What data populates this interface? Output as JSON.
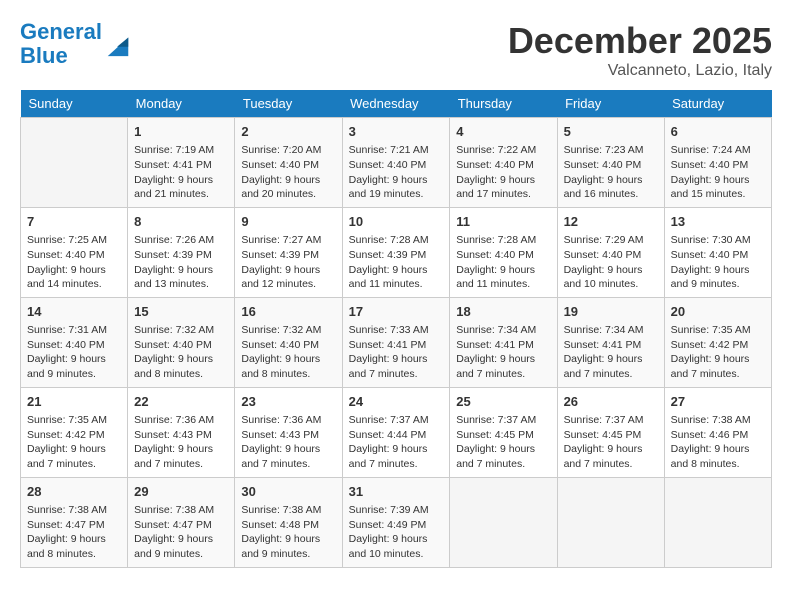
{
  "header": {
    "logo_line1": "General",
    "logo_line2": "Blue",
    "month": "December 2025",
    "location": "Valcanneto, Lazio, Italy"
  },
  "weekdays": [
    "Sunday",
    "Monday",
    "Tuesday",
    "Wednesday",
    "Thursday",
    "Friday",
    "Saturday"
  ],
  "weeks": [
    [
      {
        "day": "",
        "info": ""
      },
      {
        "day": "1",
        "info": "Sunrise: 7:19 AM\nSunset: 4:41 PM\nDaylight: 9 hours\nand 21 minutes."
      },
      {
        "day": "2",
        "info": "Sunrise: 7:20 AM\nSunset: 4:40 PM\nDaylight: 9 hours\nand 20 minutes."
      },
      {
        "day": "3",
        "info": "Sunrise: 7:21 AM\nSunset: 4:40 PM\nDaylight: 9 hours\nand 19 minutes."
      },
      {
        "day": "4",
        "info": "Sunrise: 7:22 AM\nSunset: 4:40 PM\nDaylight: 9 hours\nand 17 minutes."
      },
      {
        "day": "5",
        "info": "Sunrise: 7:23 AM\nSunset: 4:40 PM\nDaylight: 9 hours\nand 16 minutes."
      },
      {
        "day": "6",
        "info": "Sunrise: 7:24 AM\nSunset: 4:40 PM\nDaylight: 9 hours\nand 15 minutes."
      }
    ],
    [
      {
        "day": "7",
        "info": "Sunrise: 7:25 AM\nSunset: 4:40 PM\nDaylight: 9 hours\nand 14 minutes."
      },
      {
        "day": "8",
        "info": "Sunrise: 7:26 AM\nSunset: 4:39 PM\nDaylight: 9 hours\nand 13 minutes."
      },
      {
        "day": "9",
        "info": "Sunrise: 7:27 AM\nSunset: 4:39 PM\nDaylight: 9 hours\nand 12 minutes."
      },
      {
        "day": "10",
        "info": "Sunrise: 7:28 AM\nSunset: 4:39 PM\nDaylight: 9 hours\nand 11 minutes."
      },
      {
        "day": "11",
        "info": "Sunrise: 7:28 AM\nSunset: 4:40 PM\nDaylight: 9 hours\nand 11 minutes."
      },
      {
        "day": "12",
        "info": "Sunrise: 7:29 AM\nSunset: 4:40 PM\nDaylight: 9 hours\nand 10 minutes."
      },
      {
        "day": "13",
        "info": "Sunrise: 7:30 AM\nSunset: 4:40 PM\nDaylight: 9 hours\nand 9 minutes."
      }
    ],
    [
      {
        "day": "14",
        "info": "Sunrise: 7:31 AM\nSunset: 4:40 PM\nDaylight: 9 hours\nand 9 minutes."
      },
      {
        "day": "15",
        "info": "Sunrise: 7:32 AM\nSunset: 4:40 PM\nDaylight: 9 hours\nand 8 minutes."
      },
      {
        "day": "16",
        "info": "Sunrise: 7:32 AM\nSunset: 4:40 PM\nDaylight: 9 hours\nand 8 minutes."
      },
      {
        "day": "17",
        "info": "Sunrise: 7:33 AM\nSunset: 4:41 PM\nDaylight: 9 hours\nand 7 minutes."
      },
      {
        "day": "18",
        "info": "Sunrise: 7:34 AM\nSunset: 4:41 PM\nDaylight: 9 hours\nand 7 minutes."
      },
      {
        "day": "19",
        "info": "Sunrise: 7:34 AM\nSunset: 4:41 PM\nDaylight: 9 hours\nand 7 minutes."
      },
      {
        "day": "20",
        "info": "Sunrise: 7:35 AM\nSunset: 4:42 PM\nDaylight: 9 hours\nand 7 minutes."
      }
    ],
    [
      {
        "day": "21",
        "info": "Sunrise: 7:35 AM\nSunset: 4:42 PM\nDaylight: 9 hours\nand 7 minutes."
      },
      {
        "day": "22",
        "info": "Sunrise: 7:36 AM\nSunset: 4:43 PM\nDaylight: 9 hours\nand 7 minutes."
      },
      {
        "day": "23",
        "info": "Sunrise: 7:36 AM\nSunset: 4:43 PM\nDaylight: 9 hours\nand 7 minutes."
      },
      {
        "day": "24",
        "info": "Sunrise: 7:37 AM\nSunset: 4:44 PM\nDaylight: 9 hours\nand 7 minutes."
      },
      {
        "day": "25",
        "info": "Sunrise: 7:37 AM\nSunset: 4:45 PM\nDaylight: 9 hours\nand 7 minutes."
      },
      {
        "day": "26",
        "info": "Sunrise: 7:37 AM\nSunset: 4:45 PM\nDaylight: 9 hours\nand 7 minutes."
      },
      {
        "day": "27",
        "info": "Sunrise: 7:38 AM\nSunset: 4:46 PM\nDaylight: 9 hours\nand 8 minutes."
      }
    ],
    [
      {
        "day": "28",
        "info": "Sunrise: 7:38 AM\nSunset: 4:47 PM\nDaylight: 9 hours\nand 8 minutes."
      },
      {
        "day": "29",
        "info": "Sunrise: 7:38 AM\nSunset: 4:47 PM\nDaylight: 9 hours\nand 9 minutes."
      },
      {
        "day": "30",
        "info": "Sunrise: 7:38 AM\nSunset: 4:48 PM\nDaylight: 9 hours\nand 9 minutes."
      },
      {
        "day": "31",
        "info": "Sunrise: 7:39 AM\nSunset: 4:49 PM\nDaylight: 9 hours\nand 10 minutes."
      },
      {
        "day": "",
        "info": ""
      },
      {
        "day": "",
        "info": ""
      },
      {
        "day": "",
        "info": ""
      }
    ]
  ]
}
